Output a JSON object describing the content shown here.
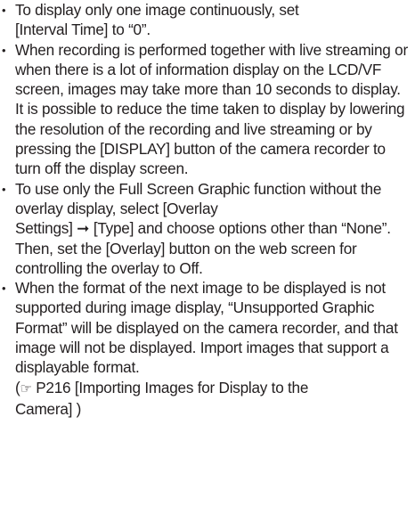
{
  "bullet_char": "•",
  "bullets": [
    {
      "p1": "To display only one image continuously, set",
      "p2": "[Interval Time] to “0”."
    },
    {
      "p1": "When recording is performed together with live streaming or when there is a lot of information display on the LCD/VF screen, images may take more than 10 seconds to display. It is possible to reduce the time taken to display by lowering the resolution of the recording and live streaming or by pressing the [DISPLAY] button of the camera recorder to turn off the display screen."
    },
    {
      "p1": "To use only the Full Screen Graphic function without the overlay display, select [Overlay",
      "p2": "Settings] ➞ [Type] and choose options other than “None”. Then, set the [Overlay] button on the web screen for controlling the overlay to Off."
    },
    {
      "p1": "When the format of the next image to be displayed is not supported during image display, “Unsupported Graphic Format” will be displayed on the camera recorder, and that image will not be displayed. Import images that support a displayable format."
    }
  ],
  "reference": {
    "open": "(",
    "icon": "☞",
    "text": " P216 [Importing Images for Display to the",
    "text2": "Camera] )"
  }
}
